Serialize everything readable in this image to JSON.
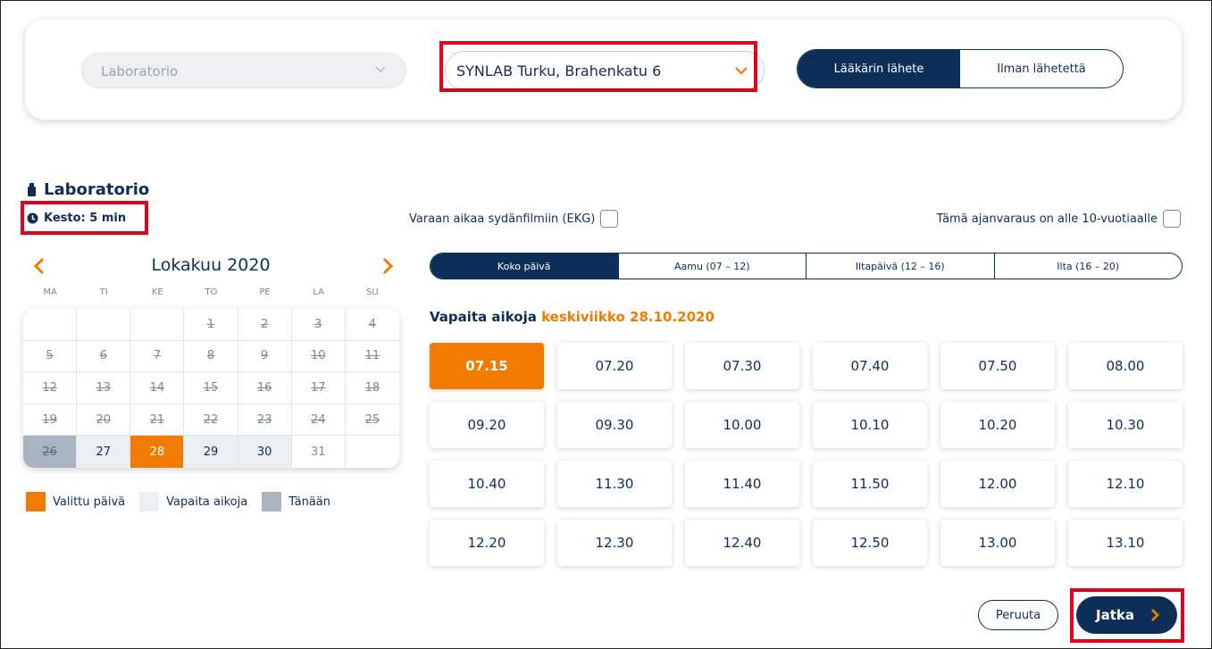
{
  "filters": {
    "service_select": {
      "value": "Laboratorio"
    },
    "location_select": {
      "value": "SYNLAB Turku, Brahenkatu 6"
    },
    "referral_toggle": {
      "options": [
        "Lääkärin lähete",
        "Ilman lähetettä"
      ],
      "selected": "Lääkärin lähete"
    }
  },
  "service": {
    "title": "Laboratorio",
    "duration": "Kesto: 5 min"
  },
  "calendar": {
    "month_title": "Lokakuu 2020",
    "weekdays": [
      "MA",
      "TI",
      "KE",
      "TO",
      "PE",
      "LA",
      "SU"
    ],
    "weeks": [
      [
        {
          "d": ""
        },
        {
          "d": ""
        },
        {
          "d": ""
        },
        {
          "d": "1",
          "s": "past"
        },
        {
          "d": "2",
          "s": "past"
        },
        {
          "d": "3",
          "s": "past"
        },
        {
          "d": "4",
          "s": "past"
        }
      ],
      [
        {
          "d": "5",
          "s": "past"
        },
        {
          "d": "6",
          "s": "past"
        },
        {
          "d": "7",
          "s": "past"
        },
        {
          "d": "8",
          "s": "past"
        },
        {
          "d": "9",
          "s": "past"
        },
        {
          "d": "10",
          "s": "past"
        },
        {
          "d": "11",
          "s": "past"
        }
      ],
      [
        {
          "d": "12",
          "s": "past"
        },
        {
          "d": "13",
          "s": "past"
        },
        {
          "d": "14",
          "s": "past"
        },
        {
          "d": "15",
          "s": "past"
        },
        {
          "d": "16",
          "s": "past"
        },
        {
          "d": "17",
          "s": "past"
        },
        {
          "d": "18",
          "s": "past"
        }
      ],
      [
        {
          "d": "19",
          "s": "past"
        },
        {
          "d": "20",
          "s": "past"
        },
        {
          "d": "21",
          "s": "past"
        },
        {
          "d": "22",
          "s": "past"
        },
        {
          "d": "23",
          "s": "past"
        },
        {
          "d": "24",
          "s": "past"
        },
        {
          "d": "25",
          "s": "past"
        }
      ],
      [
        {
          "d": "26",
          "s": "today"
        },
        {
          "d": "27",
          "s": "avail"
        },
        {
          "d": "28",
          "s": "selected"
        },
        {
          "d": "29",
          "s": "avail"
        },
        {
          "d": "30",
          "s": "avail"
        },
        {
          "d": "31"
        },
        {
          "d": ""
        }
      ]
    ],
    "legend": {
      "selected": "Valittu päivä",
      "available": "Vapaita aikoja",
      "today": "Tänään"
    }
  },
  "options": {
    "ekg_label": "Varaan aikaa sydänfilmiin (EKG)",
    "under10_label": "Tämä ajanvaraus on alle 10-vuotiaalle"
  },
  "day_parts": {
    "items": [
      "Koko päivä",
      "Aamu (07 – 12)",
      "Iltapäivä (12 – 16)",
      "Ilta (16 – 20)"
    ],
    "selected": "Koko päivä"
  },
  "free_times": {
    "label": "Vapaita aikoja",
    "date_label": "keskiviikko 28.10.2020",
    "selected": "07.15",
    "slots": [
      "07.15",
      "07.20",
      "07.30",
      "07.40",
      "07.50",
      "08.00",
      "09.20",
      "09.30",
      "10.00",
      "10.10",
      "10.20",
      "10.30",
      "10.40",
      "11.30",
      "11.40",
      "11.50",
      "12.00",
      "12.10",
      "12.20",
      "12.30",
      "12.40",
      "12.50",
      "13.00",
      "13.10"
    ]
  },
  "actions": {
    "cancel_label": "Peruuta",
    "continue_label": "Jatka"
  },
  "colors": {
    "navy": "#0d2f57",
    "orange": "#f07b00",
    "highlight_red": "#e4001b",
    "today_gray": "#a9b4c0",
    "available_gray": "#eceff2"
  }
}
